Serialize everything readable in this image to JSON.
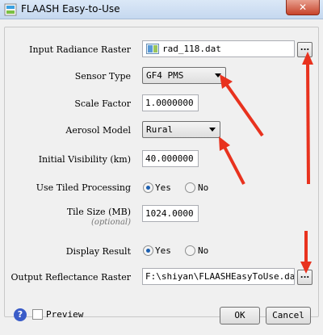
{
  "window": {
    "title": "FLAASH Easy-to-Use",
    "close_label": "✕"
  },
  "input_radiance": {
    "label": "Input Radiance Raster",
    "value": "rad_118.dat",
    "browse_label": "..."
  },
  "sensor_type": {
    "label": "Sensor Type",
    "value": "GF4 PMS"
  },
  "scale_factor": {
    "label": "Scale Factor",
    "value": "1.0000000"
  },
  "aerosol_model": {
    "label": "Aerosol Model",
    "value": "Rural"
  },
  "initial_visibility": {
    "label": "Initial Visibility (km)",
    "value": "40.000000"
  },
  "tiled_processing": {
    "label": "Use Tiled Processing",
    "yes": "Yes",
    "no": "No",
    "selected": "Yes"
  },
  "tile_size": {
    "label": "Tile Size (MB)",
    "sublabel": "(optional)",
    "value": "1024.0000"
  },
  "display_result": {
    "label": "Display Result",
    "yes": "Yes",
    "no": "No",
    "selected": "Yes"
  },
  "output_reflectance": {
    "label": "Output Reflectance Raster",
    "value": "F:\\shiyan\\FLAASHEasyToUse.dat",
    "browse_label": "..."
  },
  "footer": {
    "help_label": "?",
    "preview_label": "Preview",
    "ok_label": "OK",
    "cancel_label": "Cancel"
  },
  "colors": {
    "annotation_arrow": "#e8321e",
    "radio_selected": "#1c5fb0",
    "help_icon": "#3a5cc8"
  }
}
